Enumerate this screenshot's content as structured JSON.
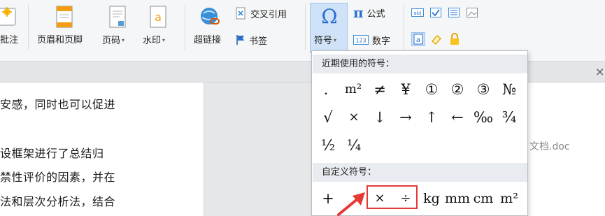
{
  "ribbon": {
    "comment_label": "批注",
    "header_footer_label": "页眉和页脚",
    "page_number_label": "页码",
    "watermark_label": "水印",
    "hyperlink_label": "超链接",
    "cross_ref_label": "交叉引用",
    "bookmark_label": "书签",
    "symbol_label": "符号",
    "formula_label": "公式",
    "number_label": "数字",
    "caret": "▾"
  },
  "document": {
    "lines": [
      "安感，同时也可以促进",
      "设框架进行了总结归",
      "禁性评价的因素，并在",
      "法和层次分析法，结合"
    ],
    "side_text": "文档.doc",
    "close_glyph": "×"
  },
  "symbol_panel": {
    "recent_title": "近期使用的符号：",
    "recent_symbols": [
      [
        ".",
        "m²",
        "≠",
        "¥",
        "①",
        "②",
        "③",
        "№"
      ],
      [
        "√",
        "×",
        "↓",
        "→",
        "↑",
        "←",
        "‰",
        "¾"
      ],
      [
        "½",
        "¼"
      ]
    ],
    "custom_title": "自定义符号：",
    "custom_symbols": [
      "+",
      "",
      "×",
      "÷",
      "kg",
      "mm",
      "cm",
      "m²"
    ]
  },
  "colors": {
    "highlight": "#e53935",
    "selected_bg": "#cfe2f7"
  }
}
